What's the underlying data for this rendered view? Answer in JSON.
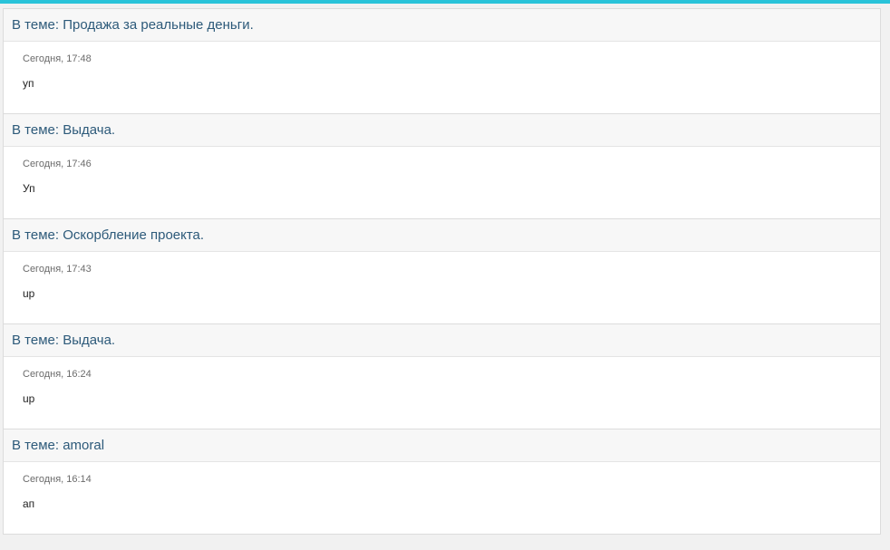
{
  "colors": {
    "accent": "#29c3d9",
    "topic_link": "#2d5a7a",
    "header_bg": "#f7f7f7",
    "border": "#dcdcdc"
  },
  "posts": [
    {
      "topic": "В теме: Продажа за реальные деньги.",
      "time": "Сегодня, 17:48",
      "text": "уп"
    },
    {
      "topic": "В теме: Выдача.",
      "time": "Сегодня, 17:46",
      "text": "Уп"
    },
    {
      "topic": "В теме: Оскорбление проекта.",
      "time": "Сегодня, 17:43",
      "text": "up"
    },
    {
      "topic": "В теме: Выдача.",
      "time": "Сегодня, 16:24",
      "text": "up"
    },
    {
      "topic": "В теме: amoral",
      "time": "Сегодня, 16:14",
      "text": "ап"
    }
  ]
}
